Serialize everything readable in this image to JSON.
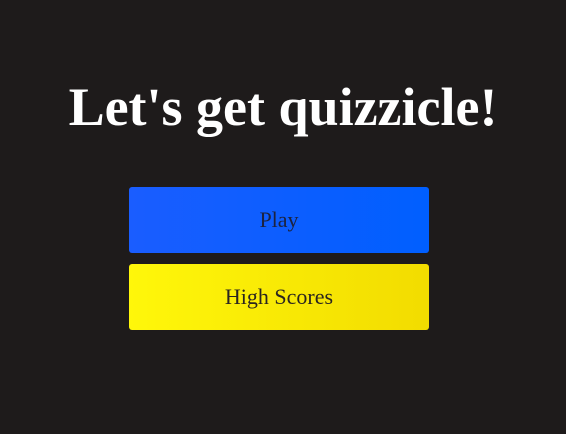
{
  "page": {
    "title": "Let's get quizzicle!"
  },
  "menu": {
    "play_label": "Play",
    "high_scores_label": "High Scores"
  },
  "colors": {
    "background": "#1e1b1b",
    "title_text": "#ffffff",
    "play_button": "#1a5dff",
    "high_scores_button": "#fff70a"
  }
}
